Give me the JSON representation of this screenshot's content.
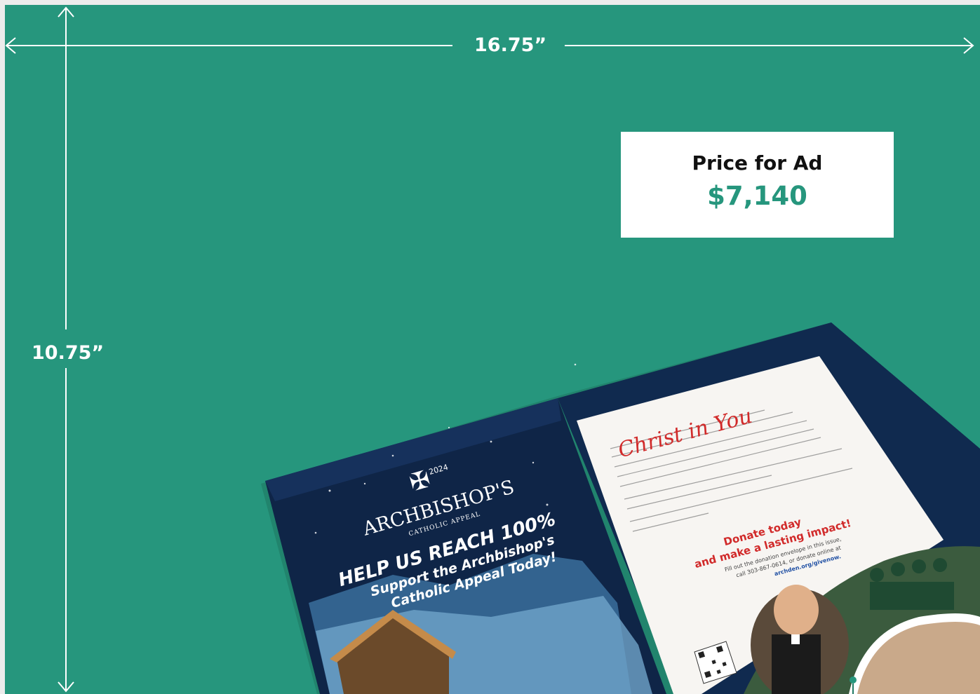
{
  "dimensions": {
    "width_label": "16.75”",
    "height_label": "10.75”"
  },
  "price": {
    "label": "Price for Ad",
    "value": "$7,140"
  },
  "magazine": {
    "left_page": {
      "logo_year": "2024",
      "logo_title": "ARCHBISHOP'S",
      "logo_subtitle": "CATHOLIC APPEAL",
      "headline_1": "HELP US REACH 100%",
      "headline_2": "Support the Archbishop's",
      "headline_3": "Catholic Appeal Today!"
    },
    "right_page": {
      "script_title": "Christ in You",
      "cta_1": "Donate today",
      "cta_2": "and make a lasting impact!",
      "fill_line": "Fill out the donation envelope in this issue,",
      "phone_line": "call 303-867-0614, or donate online at",
      "url": "archden.org/givenow."
    }
  },
  "colors": {
    "background": "#26967d",
    "accent": "#26967d",
    "price_label": "#111111",
    "white": "#ffffff",
    "cta_red": "#d12a2a",
    "link_blue": "#1f4fa3"
  }
}
